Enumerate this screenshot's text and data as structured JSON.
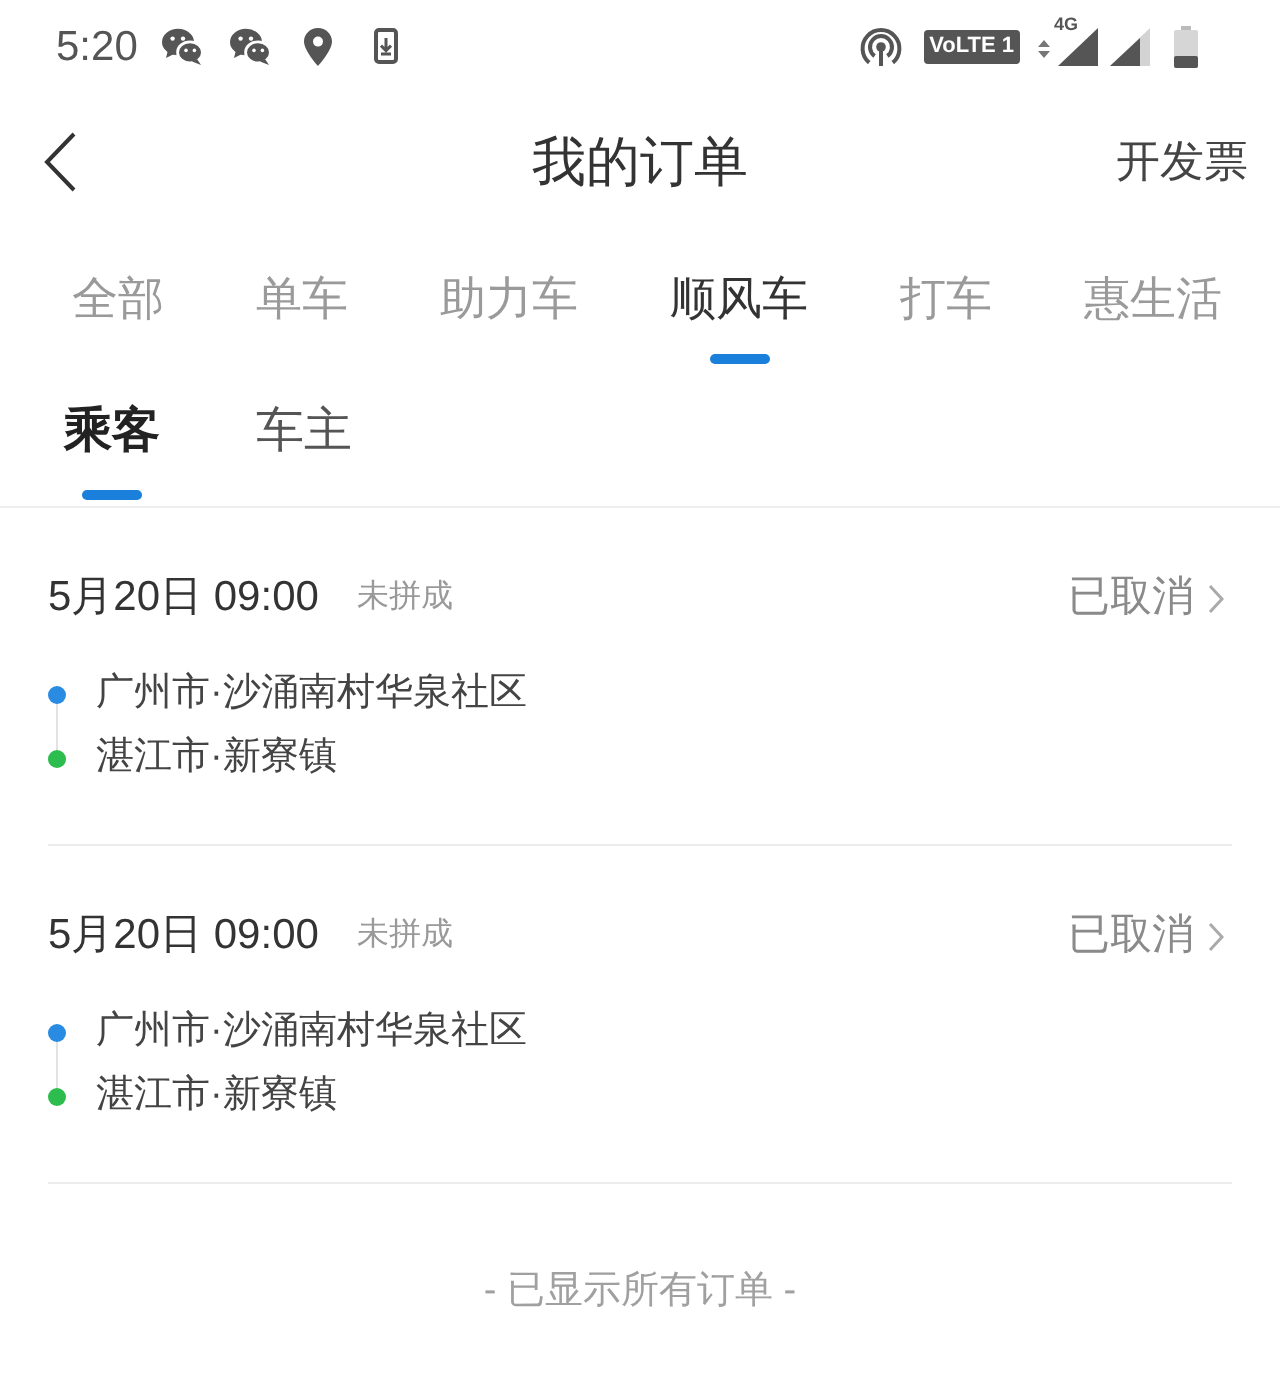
{
  "status_bar": {
    "time": "5:20",
    "network_badge": "VoLTE 1",
    "network_type": "4G"
  },
  "header": {
    "title": "我的订单",
    "action": "开发票"
  },
  "tabs": [
    {
      "label": "全部",
      "selected": false
    },
    {
      "label": "单车",
      "selected": false
    },
    {
      "label": "助力车",
      "selected": false
    },
    {
      "label": "顺风车",
      "selected": true
    },
    {
      "label": "打车",
      "selected": false
    },
    {
      "label": "惠生活",
      "selected": false
    }
  ],
  "sub_tabs": [
    {
      "label": "乘客",
      "selected": true
    },
    {
      "label": "车主",
      "selected": false
    }
  ],
  "orders": [
    {
      "datetime": "5月20日 09:00",
      "match_status": "未拼成",
      "status": "已取消",
      "stops": [
        {
          "name": "广州市·沙涌南村华泉社区",
          "color": "#2a8be2"
        },
        {
          "name": "湛江市·新寮镇",
          "color": "#2dbd4e"
        }
      ]
    },
    {
      "datetime": "5月20日 09:00",
      "match_status": "未拼成",
      "status": "已取消",
      "stops": [
        {
          "name": "广州市·沙涌南村华泉社区",
          "color": "#2a8be2"
        },
        {
          "name": "湛江市·新寮镇",
          "color": "#2dbd4e"
        }
      ]
    }
  ],
  "footer": "- 已显示所有订单 -"
}
